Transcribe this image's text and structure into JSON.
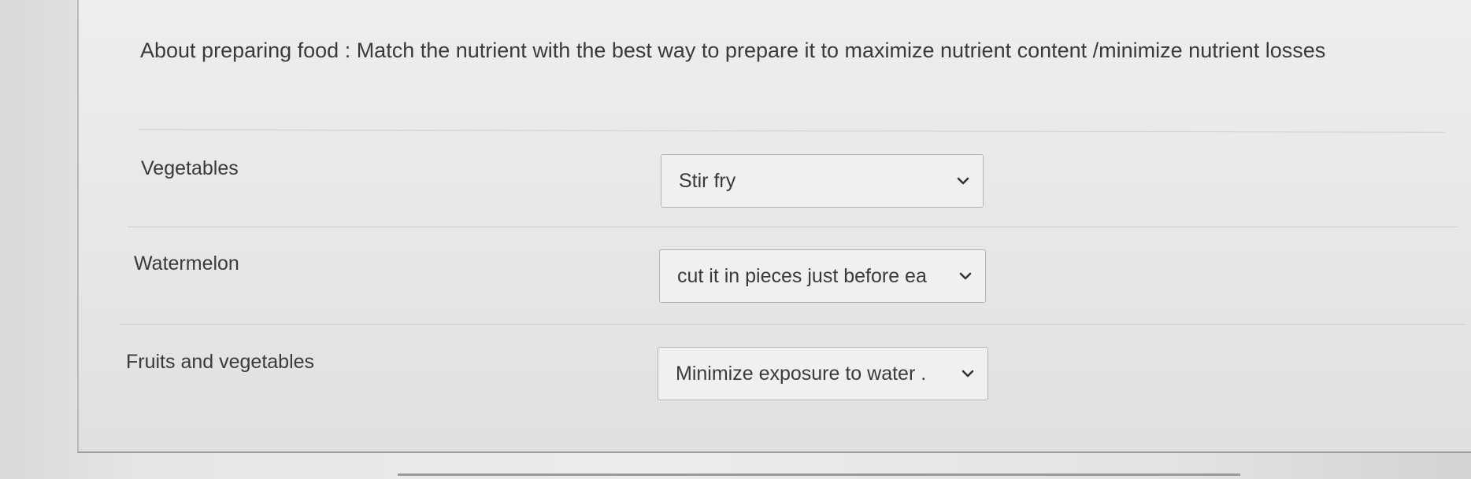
{
  "question": {
    "text": "About preparing food :  Match the nutrient with the best way to prepare it  to maximize  nutrient content /minimize nutrient losses"
  },
  "rows": [
    {
      "label": "Vegetables",
      "selected": "Stir fry"
    },
    {
      "label": "Watermelon",
      "selected": "cut it in pieces just before ea"
    },
    {
      "label": "Fruits and vegetables",
      "selected": "Minimize exposure to water ."
    }
  ],
  "icons": {
    "dropdown": "chevron-down-icon"
  },
  "colors": {
    "text": "#3a3a3a",
    "border": "#b4b4b2",
    "background": "#ececeb"
  }
}
